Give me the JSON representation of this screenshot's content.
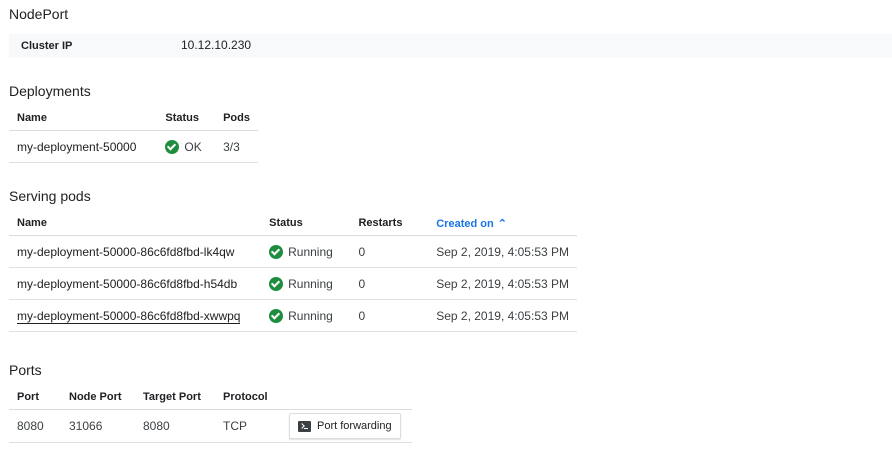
{
  "service": {
    "type": "NodePort",
    "cluster_ip_label": "Cluster IP",
    "cluster_ip_value": "10.12.10.230"
  },
  "deployments": {
    "title": "Deployments",
    "headers": {
      "name": "Name",
      "status": "Status",
      "pods": "Pods"
    },
    "rows": [
      {
        "name": "my-deployment-50000",
        "status": "OK",
        "pods": "3/3"
      }
    ]
  },
  "serving_pods": {
    "title": "Serving pods",
    "headers": {
      "name": "Name",
      "status": "Status",
      "restarts": "Restarts",
      "created_on": "Created on"
    },
    "sort_icon": "chevron-up-icon",
    "rows": [
      {
        "name": "my-deployment-50000-86c6fd8fbd-lk4qw",
        "status": "Running",
        "restarts": "0",
        "created_on": "Sep 2, 2019, 4:05:53 PM"
      },
      {
        "name": "my-deployment-50000-86c6fd8fbd-h54db",
        "status": "Running",
        "restarts": "0",
        "created_on": "Sep 2, 2019, 4:05:53 PM"
      },
      {
        "name": "my-deployment-50000-86c6fd8fbd-xwwpq",
        "status": "Running",
        "restarts": "0",
        "created_on": "Sep 2, 2019, 4:05:53 PM"
      }
    ]
  },
  "ports": {
    "title": "Ports",
    "headers": {
      "port": "Port",
      "node_port": "Node Port",
      "target_port": "Target Port",
      "protocol": "Protocol"
    },
    "rows": [
      {
        "port": "8080",
        "node_port": "31066",
        "target_port": "8080",
        "protocol": "TCP",
        "action_label": "Port forwarding",
        "action_icon": "terminal-icon"
      }
    ]
  },
  "colors": {
    "ok_green": "#1e8e3e",
    "sort_blue": "#1a73e8",
    "kv_background": "#f8f9fa"
  }
}
